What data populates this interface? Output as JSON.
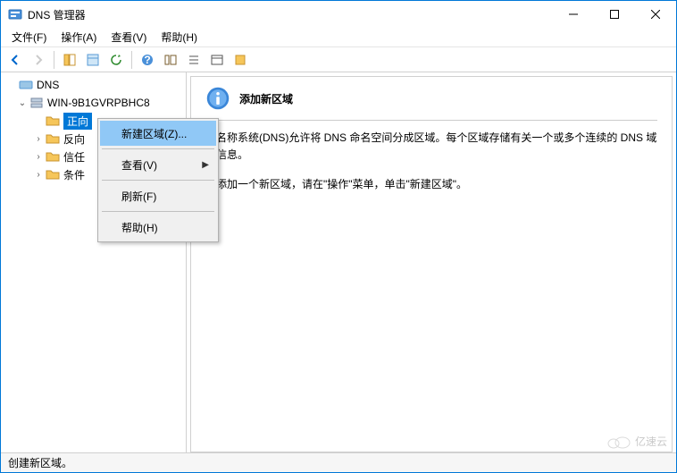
{
  "window": {
    "title": "DNS 管理器"
  },
  "menubar": [
    "文件(F)",
    "操作(A)",
    "查看(V)",
    "帮助(H)"
  ],
  "tree": {
    "root": "DNS",
    "server": "WIN-9B1GVRPBHC8",
    "items": [
      "正向",
      "反向",
      "信任",
      "条件"
    ]
  },
  "content": {
    "title": "添加新区域",
    "p1": "域名称系统(DNS)允许将 DNS 命名空间分成区域。每个区域存储有关一个或多个连续的 DNS 域的信息。",
    "p2": "要添加一个新区域，请在\"操作\"菜单，单击\"新建区域\"。"
  },
  "context_menu": {
    "new_zone": "新建区域(Z)...",
    "view": "查看(V)",
    "refresh": "刷新(F)",
    "help": "帮助(H)"
  },
  "statusbar": {
    "text": "创建新区域。"
  },
  "watermark": "亿速云"
}
